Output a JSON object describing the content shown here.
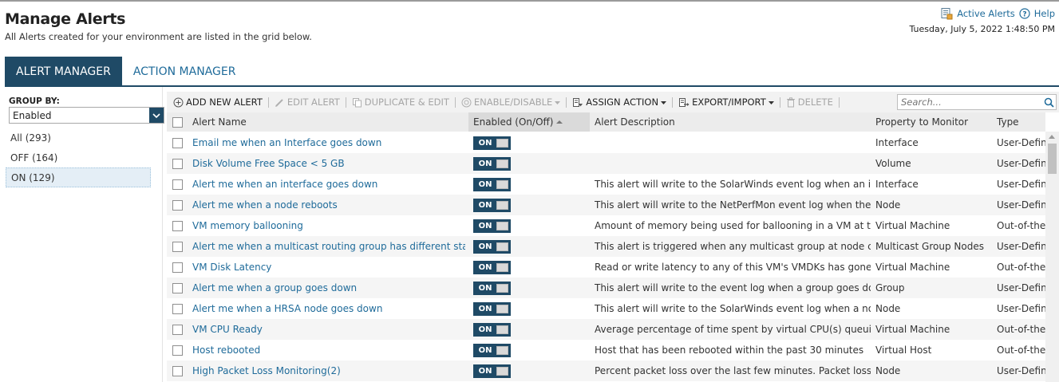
{
  "header": {
    "title": "Manage Alerts",
    "subtitle": "All Alerts created for your environment are listed in the grid below.",
    "active_alerts_label": "Active Alerts",
    "help_label": "Help",
    "datetime": "Tuesday, July 5, 2022 1:48:50 PM"
  },
  "tabs": [
    {
      "label": "ALERT MANAGER",
      "active": true
    },
    {
      "label": "ACTION MANAGER",
      "active": false
    }
  ],
  "group_by": {
    "label": "GROUP BY:",
    "selected": "Enabled",
    "groups": [
      {
        "label": "All (293)",
        "selected": false
      },
      {
        "label": "OFF (164)",
        "selected": false
      },
      {
        "label": "ON (129)",
        "selected": true
      }
    ]
  },
  "toolbar": {
    "add_new_alert": "ADD NEW ALERT",
    "edit_alert": "EDIT ALERT",
    "duplicate_edit": "DUPLICATE & EDIT",
    "enable_disable": "ENABLE/DISABLE",
    "assign_action": "ASSIGN ACTION",
    "export_import": "EXPORT/IMPORT",
    "delete": "DELETE",
    "search_placeholder": "Search..."
  },
  "columns": {
    "name": "Alert Name",
    "enabled": "Enabled (On/Off)",
    "description": "Alert Description",
    "property": "Property to Monitor",
    "type": "Type"
  },
  "rows": [
    {
      "name": "Email me when an Interface goes down",
      "enabled": "ON",
      "description": "",
      "property": "Interface",
      "type": "User-Defin"
    },
    {
      "name": "Disk Volume Free Space < 5 GB",
      "enabled": "ON",
      "description": "",
      "property": "Volume",
      "type": "User-Defin"
    },
    {
      "name": "Alert me when an interface goes down",
      "enabled": "ON",
      "description": "This alert will write to the SolarWinds event log when an int...",
      "property": "Interface",
      "type": "User-Defin"
    },
    {
      "name": "Alert me when a node reboots",
      "enabled": "ON",
      "description": "This alert will write to the NetPerfMon event log when the d...",
      "property": "Node",
      "type": "User-Defin"
    },
    {
      "name": "VM memory ballooning",
      "enabled": "ON",
      "description": "Amount of memory being used for ballooning in a VM at th...",
      "property": "Virtual Machine",
      "type": "Out-of-the-"
    },
    {
      "name": "Alert me when a multicast routing group has different statu...",
      "enabled": "ON",
      "description": "This alert is triggered when any multicast group at node ch...",
      "property": "Multicast Group Nodes",
      "type": "User-Defin"
    },
    {
      "name": "VM Disk Latency",
      "enabled": "ON",
      "description": "Read or write latency to any of this VM's VMDKs has gone a...",
      "property": "Virtual Machine",
      "type": "Out-of-the-"
    },
    {
      "name": "Alert me when a group goes down",
      "enabled": "ON",
      "description": "This alert will write to the event log when a group goes dow...",
      "property": "Group",
      "type": "User-Defin"
    },
    {
      "name": "Alert me when a HRSA node goes down",
      "enabled": "ON",
      "description": "This alert will write to the SolarWinds event log when a nod...",
      "property": "Node",
      "type": "User-Defin"
    },
    {
      "name": "VM CPU Ready",
      "enabled": "ON",
      "description": "Average percentage of time spent by virtual CPU(s) queuing...",
      "property": "Virtual Machine",
      "type": "Out-of-the-"
    },
    {
      "name": "Host rebooted",
      "enabled": "ON",
      "description": "Host that has been rebooted within the past 30 minutes",
      "property": "Virtual Host",
      "type": "Out-of-the-"
    },
    {
      "name": "High Packet Loss Monitoring(2)",
      "enabled": "ON",
      "description": "Percent packet loss over the last few minutes. Packet loss is...",
      "property": "Node",
      "type": "User-Defin"
    }
  ],
  "colors": {
    "accent_dark": "#1f4a66",
    "link": "#1f6b9a"
  }
}
